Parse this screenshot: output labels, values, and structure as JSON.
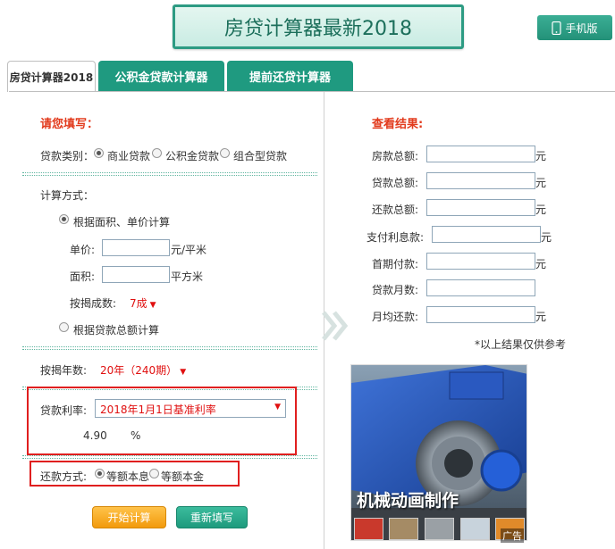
{
  "header": {
    "title": "房贷计算器最新2018",
    "mobile_label": "手机版"
  },
  "tabs": [
    {
      "label": "房贷计算器2018"
    },
    {
      "label": "公积金贷款计算器"
    },
    {
      "label": "提前还贷计算器"
    }
  ],
  "form": {
    "heading": "请您填写：",
    "loan_type": {
      "label": "贷款类别：",
      "options": [
        "商业贷款",
        "公积金贷款",
        "组合型贷款"
      ]
    },
    "calc_method": {
      "label": "计算方式：",
      "option_area": "根据面积、单价计算",
      "unit_price_label": "单价:",
      "unit_price_unit": "元/平米",
      "area_label": "面积:",
      "area_unit": "平方米",
      "ratio_label": "按揭成数:",
      "ratio_value": "7成",
      "option_total": "根据贷款总额计算"
    },
    "years": {
      "label": "按揭年数:",
      "value": "20年（240期）"
    },
    "rate": {
      "label": "贷款利率:",
      "value": "2018年1月1日基准利率",
      "number": "4.90",
      "unit": "%"
    },
    "repay": {
      "label": "还款方式:",
      "options": [
        "等额本息",
        "等额本金"
      ]
    },
    "buttons": {
      "calc": "开始计算",
      "reset": "重新填写"
    }
  },
  "result": {
    "heading": "查看结果:",
    "rows": [
      {
        "label": "房款总额:",
        "unit": "元"
      },
      {
        "label": "贷款总额:",
        "unit": "元"
      },
      {
        "label": "还款总额:",
        "unit": "元"
      },
      {
        "label": "支付利息款:",
        "unit": "元"
      },
      {
        "label": "首期付款:",
        "unit": "元"
      },
      {
        "label": "贷款月数:",
        "unit": ""
      },
      {
        "label": "月均还款:",
        "unit": "元"
      }
    ],
    "note": "*以上结果仅供参考"
  },
  "ad": {
    "caption": "机械动画制作",
    "tag": "广告"
  },
  "colors": {
    "accent": "#1f9a80",
    "highlight": "#e01f1f",
    "heading_red": "#e23a1c"
  }
}
